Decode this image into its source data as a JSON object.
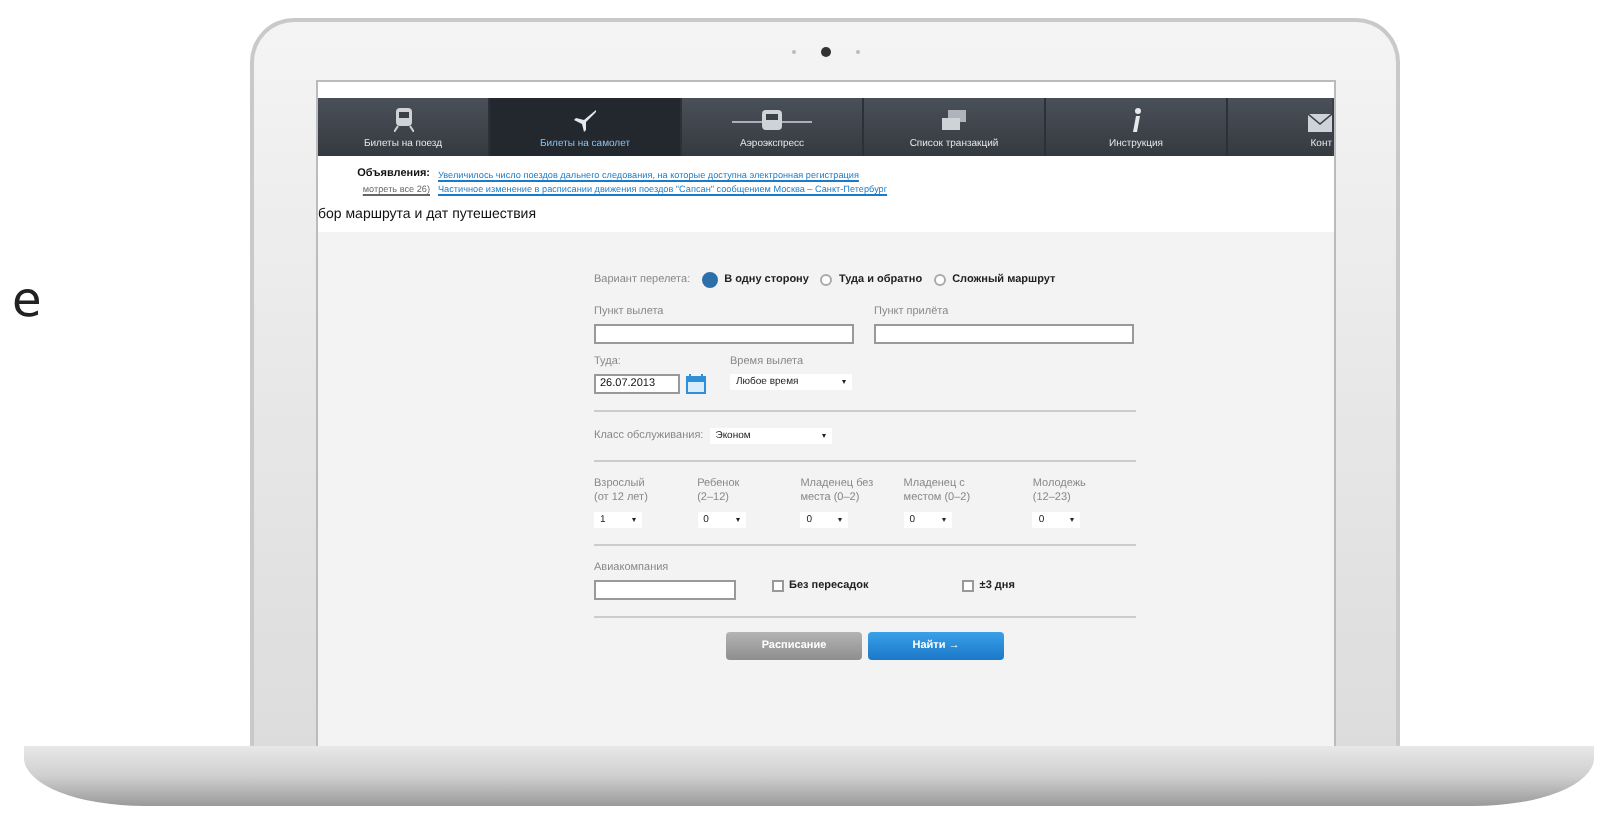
{
  "outside_text": "е",
  "nav": {
    "tabs": [
      {
        "label": "Билеты на поезд",
        "kind": "train",
        "selected": false
      },
      {
        "label": "Билеты на самолет",
        "kind": "plane",
        "selected": true
      },
      {
        "label": "Аэроэкспресс",
        "kind": "aeroexpress",
        "selected": false
      },
      {
        "label": "Список транзакций",
        "kind": "cards",
        "selected": false
      },
      {
        "label": "Инструкция",
        "kind": "info",
        "selected": false
      },
      {
        "label": "Конт",
        "kind": "mail",
        "selected": false
      }
    ]
  },
  "announcements": {
    "label": "Объявления:",
    "more_link": "мотреть все 26)",
    "items": [
      "Увеличилось число поездов дальнего следования, на которые доступна электронная регистрация",
      "Частичное изменение в расписании движения поездов \"Сапсан\" сообщением Москва – Санкт-Петербург"
    ]
  },
  "section_title": "бор маршрута и дат путешествия",
  "form": {
    "trip_type": {
      "label": "Вариант перелета:",
      "options": [
        {
          "label": "В одну сторону",
          "selected": true
        },
        {
          "label": "Туда и обратно",
          "selected": false
        },
        {
          "label": "Сложный маршрут",
          "selected": false
        }
      ]
    },
    "from": {
      "label": "Пункт вылета"
    },
    "to": {
      "label": "Пункт прилёта"
    },
    "date": {
      "label": "Туда:",
      "value": "26.07.2013"
    },
    "time": {
      "label": "Время вылета",
      "value": "Любое время"
    },
    "service_class": {
      "label": "Класс обслуживания:",
      "value": "Эконом"
    },
    "passengers": [
      {
        "label_lines": [
          "Взрослый",
          "(от 12 лет)"
        ],
        "value": "1"
      },
      {
        "label_lines": [
          "Ребенок",
          "(2–12)"
        ],
        "value": "0"
      },
      {
        "label_lines": [
          "Младенец без",
          "места (0–2)"
        ],
        "value": "0"
      },
      {
        "label_lines": [
          "Младенец с",
          "местом (0–2)"
        ],
        "value": "0"
      },
      {
        "label_lines": [
          "Молодежь",
          "(12–23)"
        ],
        "value": "0"
      }
    ],
    "airline": {
      "label": "Авиакомпания"
    },
    "options": [
      {
        "label": "Без пересадок",
        "checked": false
      },
      {
        "label": "±3 дня",
        "checked": false
      }
    ],
    "buttons": [
      {
        "label": "Расписание",
        "kind": "secondary"
      },
      {
        "label": "Найти →",
        "kind": "primary"
      }
    ]
  }
}
